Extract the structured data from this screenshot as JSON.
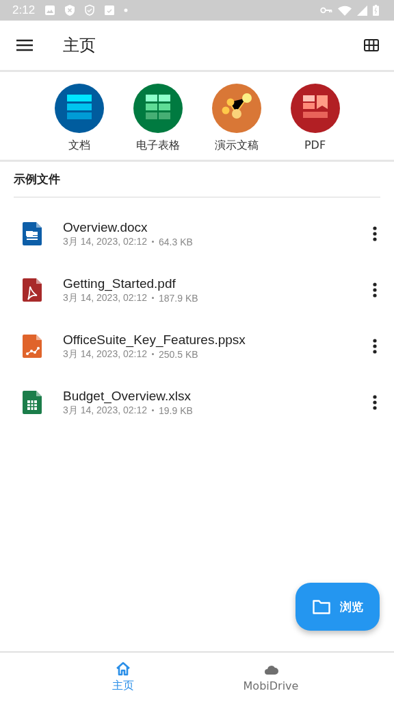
{
  "status_bar": {
    "time": "2:12"
  },
  "app_bar": {
    "title": "主页"
  },
  "quick_actions": [
    {
      "kind": "doc",
      "label": "文档"
    },
    {
      "kind": "sheet",
      "label": "电子表格"
    },
    {
      "kind": "slides",
      "label": "演示文稿"
    },
    {
      "kind": "pdf",
      "label": "PDF"
    }
  ],
  "section": {
    "title": "示例文件"
  },
  "files": [
    {
      "kind": "doc",
      "name": "Overview.docx",
      "date": "3月 14, 2023, 02:12",
      "size": "64.3 KB"
    },
    {
      "kind": "pdf",
      "name": "Getting_Started.pdf",
      "date": "3月 14, 2023, 02:12",
      "size": "187.9 KB"
    },
    {
      "kind": "slides",
      "name": "OfficeSuite_Key_Features.ppsx",
      "date": "3月 14, 2023, 02:12",
      "size": "250.5 KB"
    },
    {
      "kind": "sheet",
      "name": "Budget_Overview.xlsx",
      "date": "3月 14, 2023, 02:12",
      "size": "19.9 KB"
    }
  ],
  "fab": {
    "label": "浏览"
  },
  "bottom_nav": [
    {
      "kind": "home",
      "label": "主页",
      "selected": true
    },
    {
      "kind": "cloud",
      "label": "MobiDrive",
      "selected": false
    }
  ]
}
